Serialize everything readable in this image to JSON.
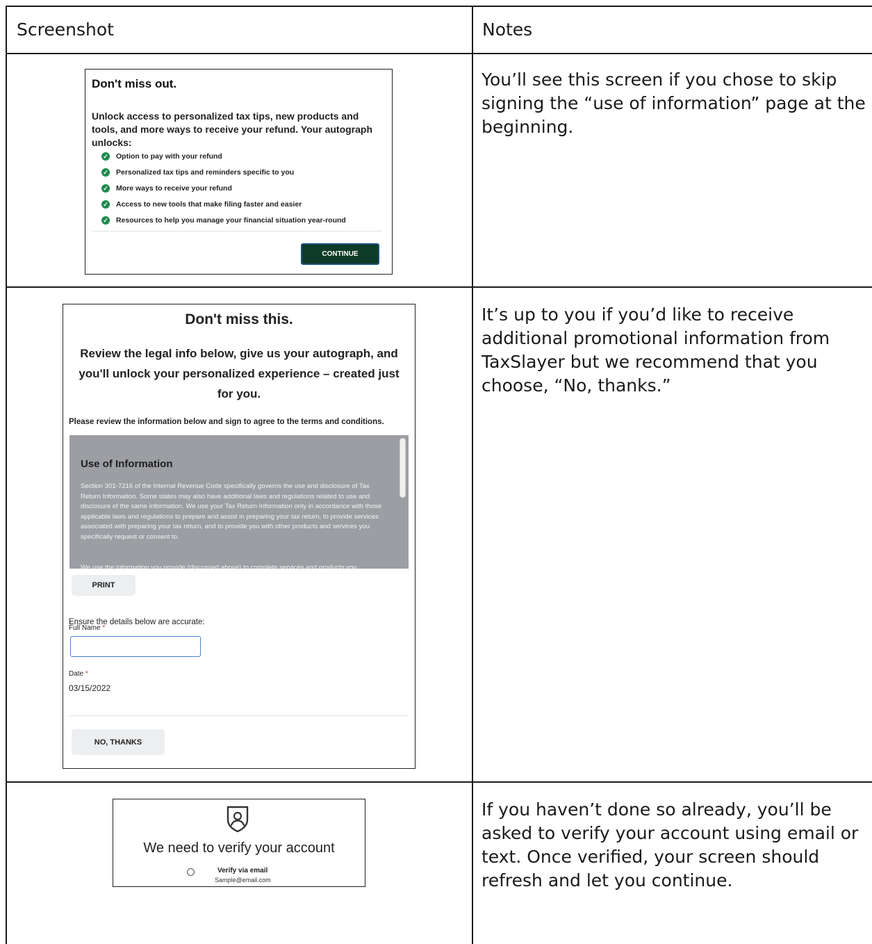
{
  "table": {
    "headers": [
      "Screenshot",
      "Notes"
    ],
    "notes": [
      "You’ll see this screen if you chose to skip signing the “use of information” page at the beginning.",
      "It’s up to you if you’d like to receive additional promotional information from TaxSlayer but we recommend that you choose, “No, thanks.”",
      "If you haven’t done so already, you’ll be asked to verify your account using email or text. Once verified, your screen should refresh and let you continue."
    ]
  },
  "card1": {
    "title": "Don't miss out.",
    "subtitle": "Unlock access to personalized tax tips, new products and tools, and more ways to receive your refund. Your autograph unlocks:",
    "items": [
      "Option to pay with your refund",
      "Personalized tax tips and reminders specific to you",
      "More ways to receive your refund",
      "Access to new tools that make filing faster and easier",
      "Resources to help you manage your financial situation year-round"
    ],
    "continue_label": "CONTINUE",
    "check_icon": "check-circle-icon",
    "button_color": "#0e3b27"
  },
  "card2": {
    "title": "Don't miss this.",
    "subtitle": "Review the legal info below, give us your autograph, and you'll unlock your personalized experience – created just for you.",
    "instructions": "Please review the information below and sign to agree to the terms and conditions.",
    "legal_heading": "Use of Information",
    "legal_p1": "Section 301-7216 of the Internal Revenue Code specifically governs the use and disclosure of Tax Return Information. Some states may also have additional laws and regulations related to use and disclosure of the same information. We use your Tax Return Information only in accordance with those applicable laws and regulations to prepare and assist in preparing your tax return, to provide services associated with preparing your tax return, and to provide you with other products and services you specifically request or consent to.",
    "legal_p2": "We use the information you provide (discussed above) to complete services and products you",
    "print_label": "PRINT",
    "ensure_label": "Ensure the details below are accurate:",
    "full_name_label": "Full Name",
    "full_name_value": "",
    "required_mark": "*",
    "date_label": "Date",
    "date_value": "03/15/2022",
    "no_thanks_label": "NO, THANKS",
    "legal_box_color": "#9c9ea3"
  },
  "card3": {
    "icon": "shield-user-icon",
    "title": "We need to verify your account",
    "option_label": "Verify via email",
    "email": "Sample@email.com"
  }
}
